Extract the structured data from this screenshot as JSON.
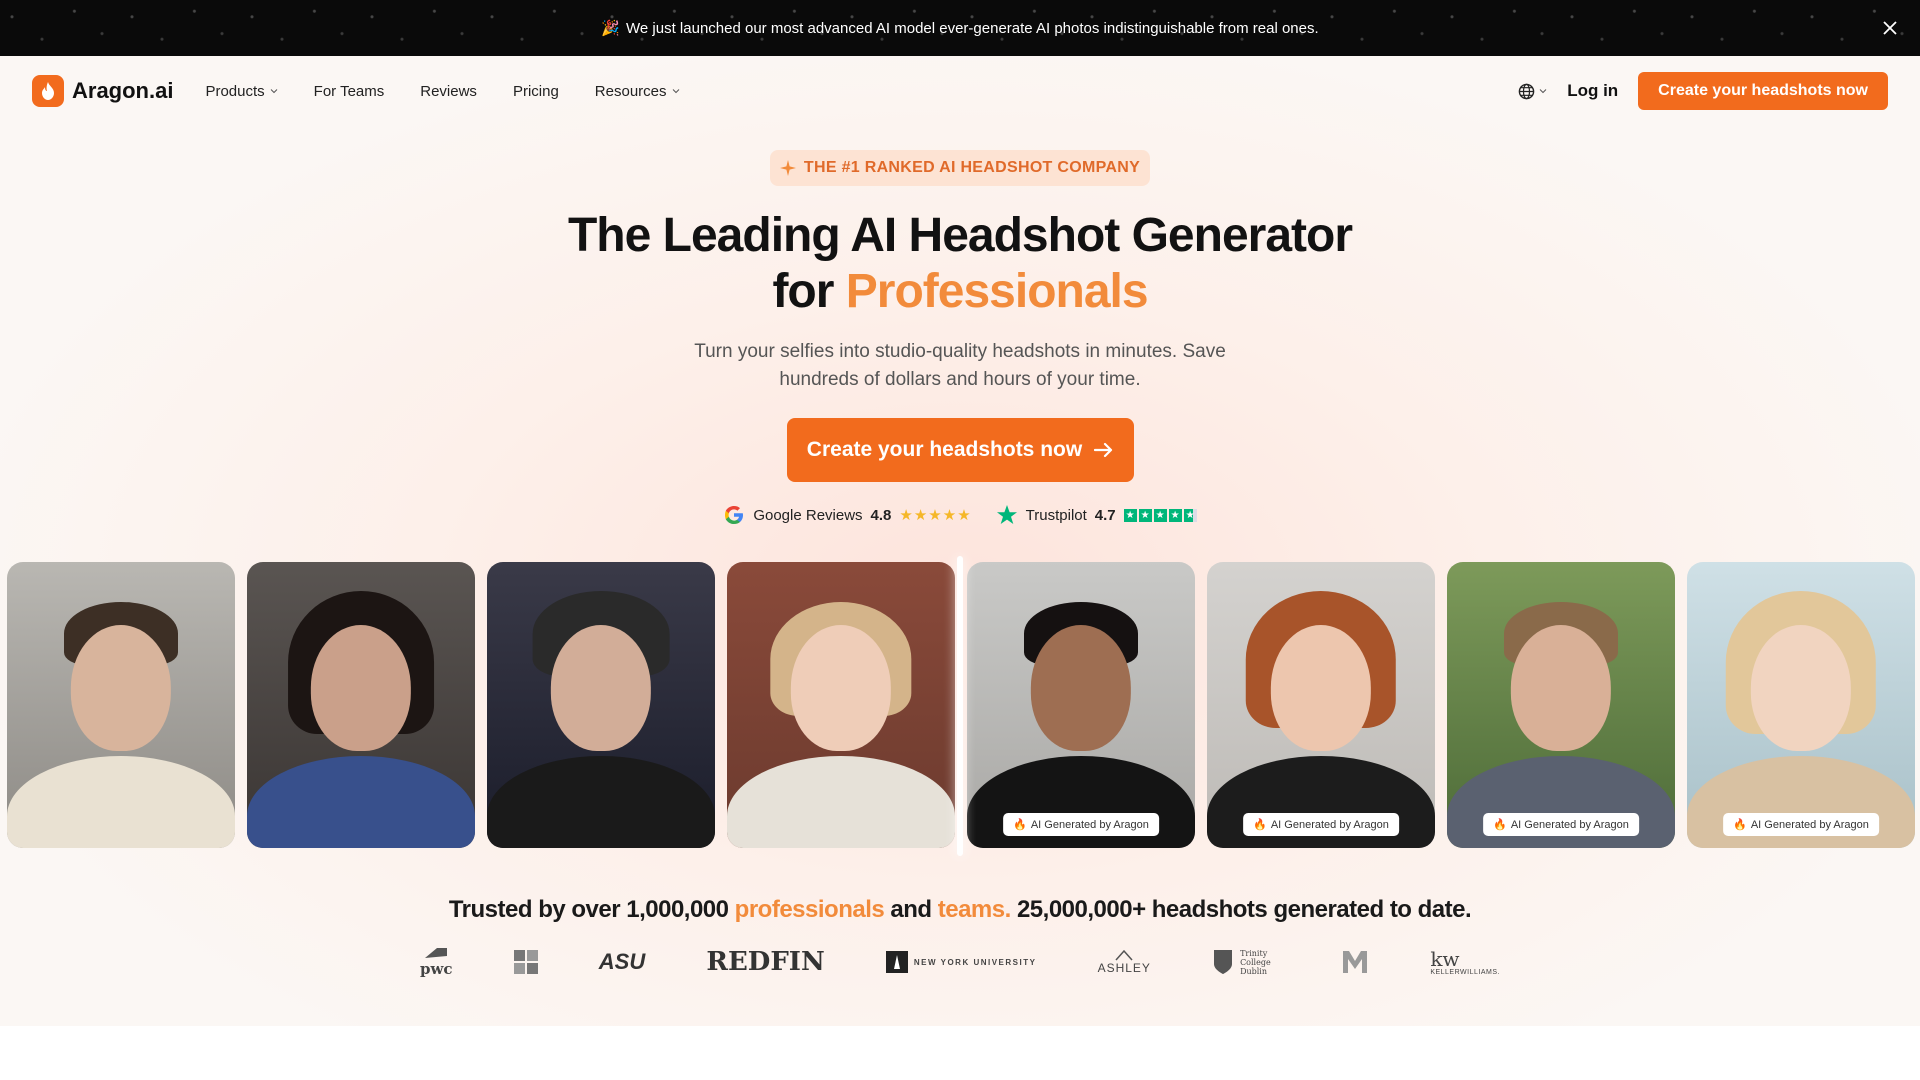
{
  "announcement": {
    "emoji": "🎉",
    "text": "We just launched our most advanced AI model ever-generate AI photos indistinguishable from real ones."
  },
  "nav": {
    "brand": "Aragon.ai",
    "links": [
      {
        "label": "Products",
        "dropdown": true
      },
      {
        "label": "For Teams",
        "dropdown": false
      },
      {
        "label": "Reviews",
        "dropdown": false
      },
      {
        "label": "Pricing",
        "dropdown": false
      },
      {
        "label": "Resources",
        "dropdown": true
      }
    ],
    "login": "Log in",
    "cta": "Create your headshots now"
  },
  "hero": {
    "badge": "THE #1 RANKED AI HEADSHOT COMPANY",
    "title_line1": "The Leading AI Headshot Generator",
    "title_line2_prefix": "for ",
    "title_line2_accent": "Professionals",
    "subtitle": "Turn your selfies into studio-quality headshots in minutes. Save hundreds of dollars and hours of your time.",
    "cta": "Create your headshots now"
  },
  "ratings": {
    "google": {
      "label": "Google Reviews",
      "score": "4.8",
      "stars": "★★★★★"
    },
    "trustpilot": {
      "label": "Trustpilot",
      "score": "4.7"
    }
  },
  "photos": {
    "ai_label": "AI Generated by Aragon"
  },
  "trusted": {
    "prefix": "Trusted by over 1,000,000 ",
    "professionals": "professionals",
    "and": " and ",
    "teams": "teams.",
    "suffix": " 25,000,000+ headshots generated to date."
  },
  "logos": {
    "pwc": "pwc",
    "asu": "ASU",
    "redfin": "REDFIN",
    "nyu": "NEW YORK UNIVERSITY",
    "ashley": "ASHLEY",
    "trinity": "Trinity College Dublin",
    "kw": "kw",
    "kw_sub": "KELLERWILLIAMS."
  },
  "colors": {
    "accent": "#f26b1d",
    "accent_text": "#f28b3b",
    "announcement_bg": "#0a0a0a"
  }
}
